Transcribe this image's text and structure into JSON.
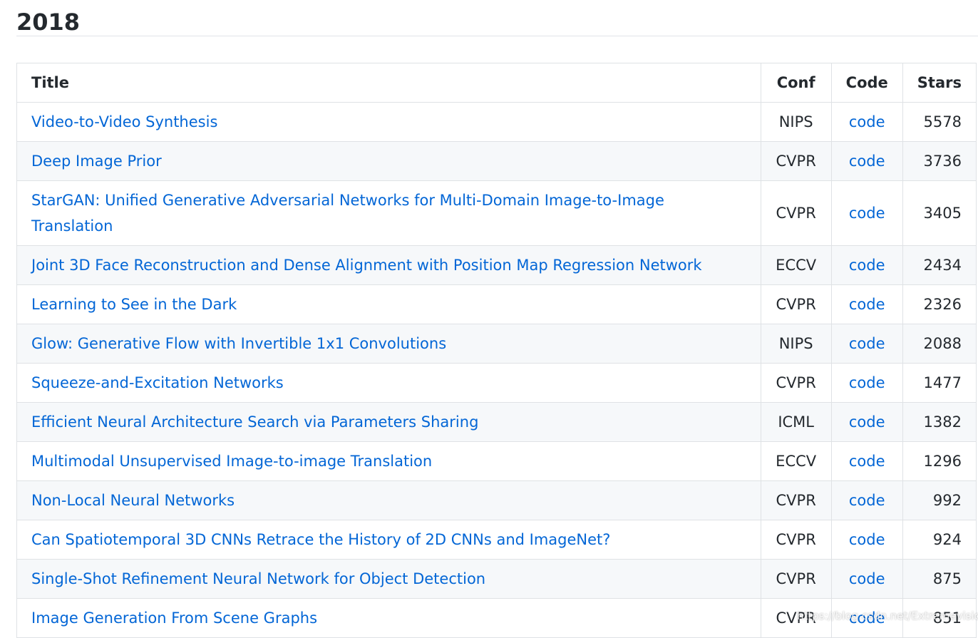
{
  "heading": "2018",
  "table": {
    "headers": {
      "title": "Title",
      "conf": "Conf",
      "code": "Code",
      "stars": "Stars"
    },
    "rows": [
      {
        "title": "Video-to-Video Synthesis",
        "conf": "NIPS",
        "code": "code",
        "stars": "5578"
      },
      {
        "title": "Deep Image Prior",
        "conf": "CVPR",
        "code": "code",
        "stars": "3736"
      },
      {
        "title": "StarGAN: Unified Generative Adversarial Networks for Multi-Domain Image-to-Image Translation",
        "conf": "CVPR",
        "code": "code",
        "stars": "3405"
      },
      {
        "title": "Joint 3D Face Reconstruction and Dense Alignment with Position Map Regression Network",
        "conf": "ECCV",
        "code": "code",
        "stars": "2434"
      },
      {
        "title": "Learning to See in the Dark",
        "conf": "CVPR",
        "code": "code",
        "stars": "2326"
      },
      {
        "title": "Glow: Generative Flow with Invertible 1x1 Convolutions",
        "conf": "NIPS",
        "code": "code",
        "stars": "2088"
      },
      {
        "title": "Squeeze-and-Excitation Networks",
        "conf": "CVPR",
        "code": "code",
        "stars": "1477"
      },
      {
        "title": "Efficient Neural Architecture Search via Parameters Sharing",
        "conf": "ICML",
        "code": "code",
        "stars": "1382"
      },
      {
        "title": "Multimodal Unsupervised Image-to-image Translation",
        "conf": "ECCV",
        "code": "code",
        "stars": "1296"
      },
      {
        "title": "Non-Local Neural Networks",
        "conf": "CVPR",
        "code": "code",
        "stars": "992"
      },
      {
        "title": "Can Spatiotemporal 3D CNNs Retrace the History of 2D CNNs and ImageNet?",
        "conf": "CVPR",
        "code": "code",
        "stars": "924"
      },
      {
        "title": "Single-Shot Refinement Neural Network for Object Detection",
        "conf": "CVPR",
        "code": "code",
        "stars": "875"
      },
      {
        "title": "Image Generation From Scene Graphs",
        "conf": "CVPR",
        "code": "code",
        "stars": "851"
      }
    ]
  },
  "watermark": "https://blog.csdn.net/Extremevision"
}
